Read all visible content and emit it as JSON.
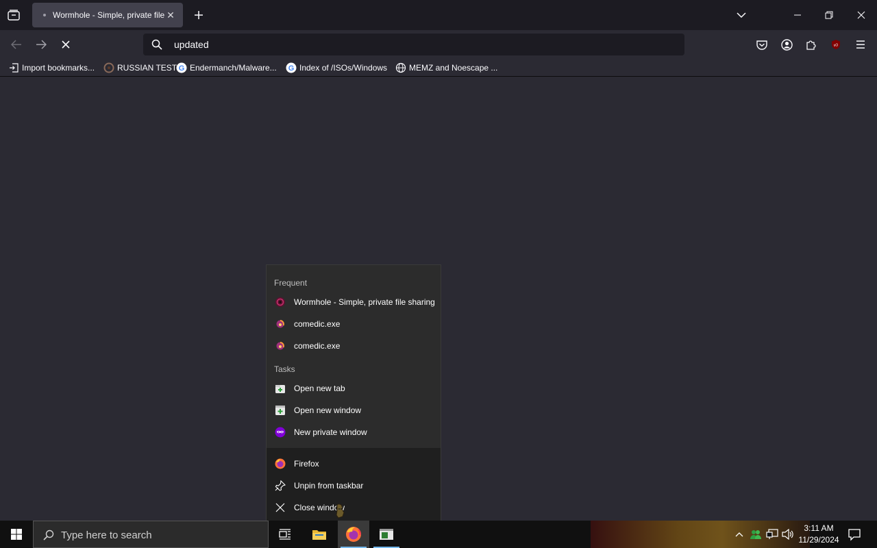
{
  "browser": {
    "tab_title": "Wormhole - Simple, private file sharing",
    "url_text": "updated",
    "bookmarks": [
      {
        "label": "Import bookmarks...",
        "icon": "import-icon"
      },
      {
        "label": "RUSSIAN TEST",
        "icon": "site-favicon"
      },
      {
        "label": "Endermanch/Malware...",
        "icon": "google-icon"
      },
      {
        "label": "Index of /ISOs/Windows",
        "icon": "google-icon"
      },
      {
        "label": "MEMZ and Noescape ...",
        "icon": "globe-icon"
      }
    ]
  },
  "jumplist": {
    "frequent_heading": "Frequent",
    "frequent": [
      {
        "label": "Wormhole - Simple, private file sharing",
        "icon": "wormhole-icon"
      },
      {
        "label": "comedic.exe",
        "icon": "firefox-file-icon"
      },
      {
        "label": "comedic.exe",
        "icon": "firefox-file-icon"
      }
    ],
    "tasks_heading": "Tasks",
    "tasks": [
      {
        "label": "Open new tab",
        "icon": "new-tab-icon"
      },
      {
        "label": "Open new window",
        "icon": "new-window-icon"
      },
      {
        "label": "New private window",
        "icon": "private-window-icon"
      }
    ],
    "app_items": [
      {
        "label": "Firefox",
        "icon": "firefox-icon"
      },
      {
        "label": "Unpin from taskbar",
        "icon": "unpin-icon"
      },
      {
        "label": "Close window",
        "icon": "close-icon"
      }
    ]
  },
  "taskbar": {
    "search_placeholder": "Type here to search",
    "time": "3:11 AM",
    "date": "11/29/2024"
  },
  "colors": {
    "chrome_dark": "#1c1b22",
    "chrome": "#2b2a33",
    "tab_selected": "#42414d",
    "taskbar": "#101010",
    "taskbar_accent": "#76b9ed"
  }
}
